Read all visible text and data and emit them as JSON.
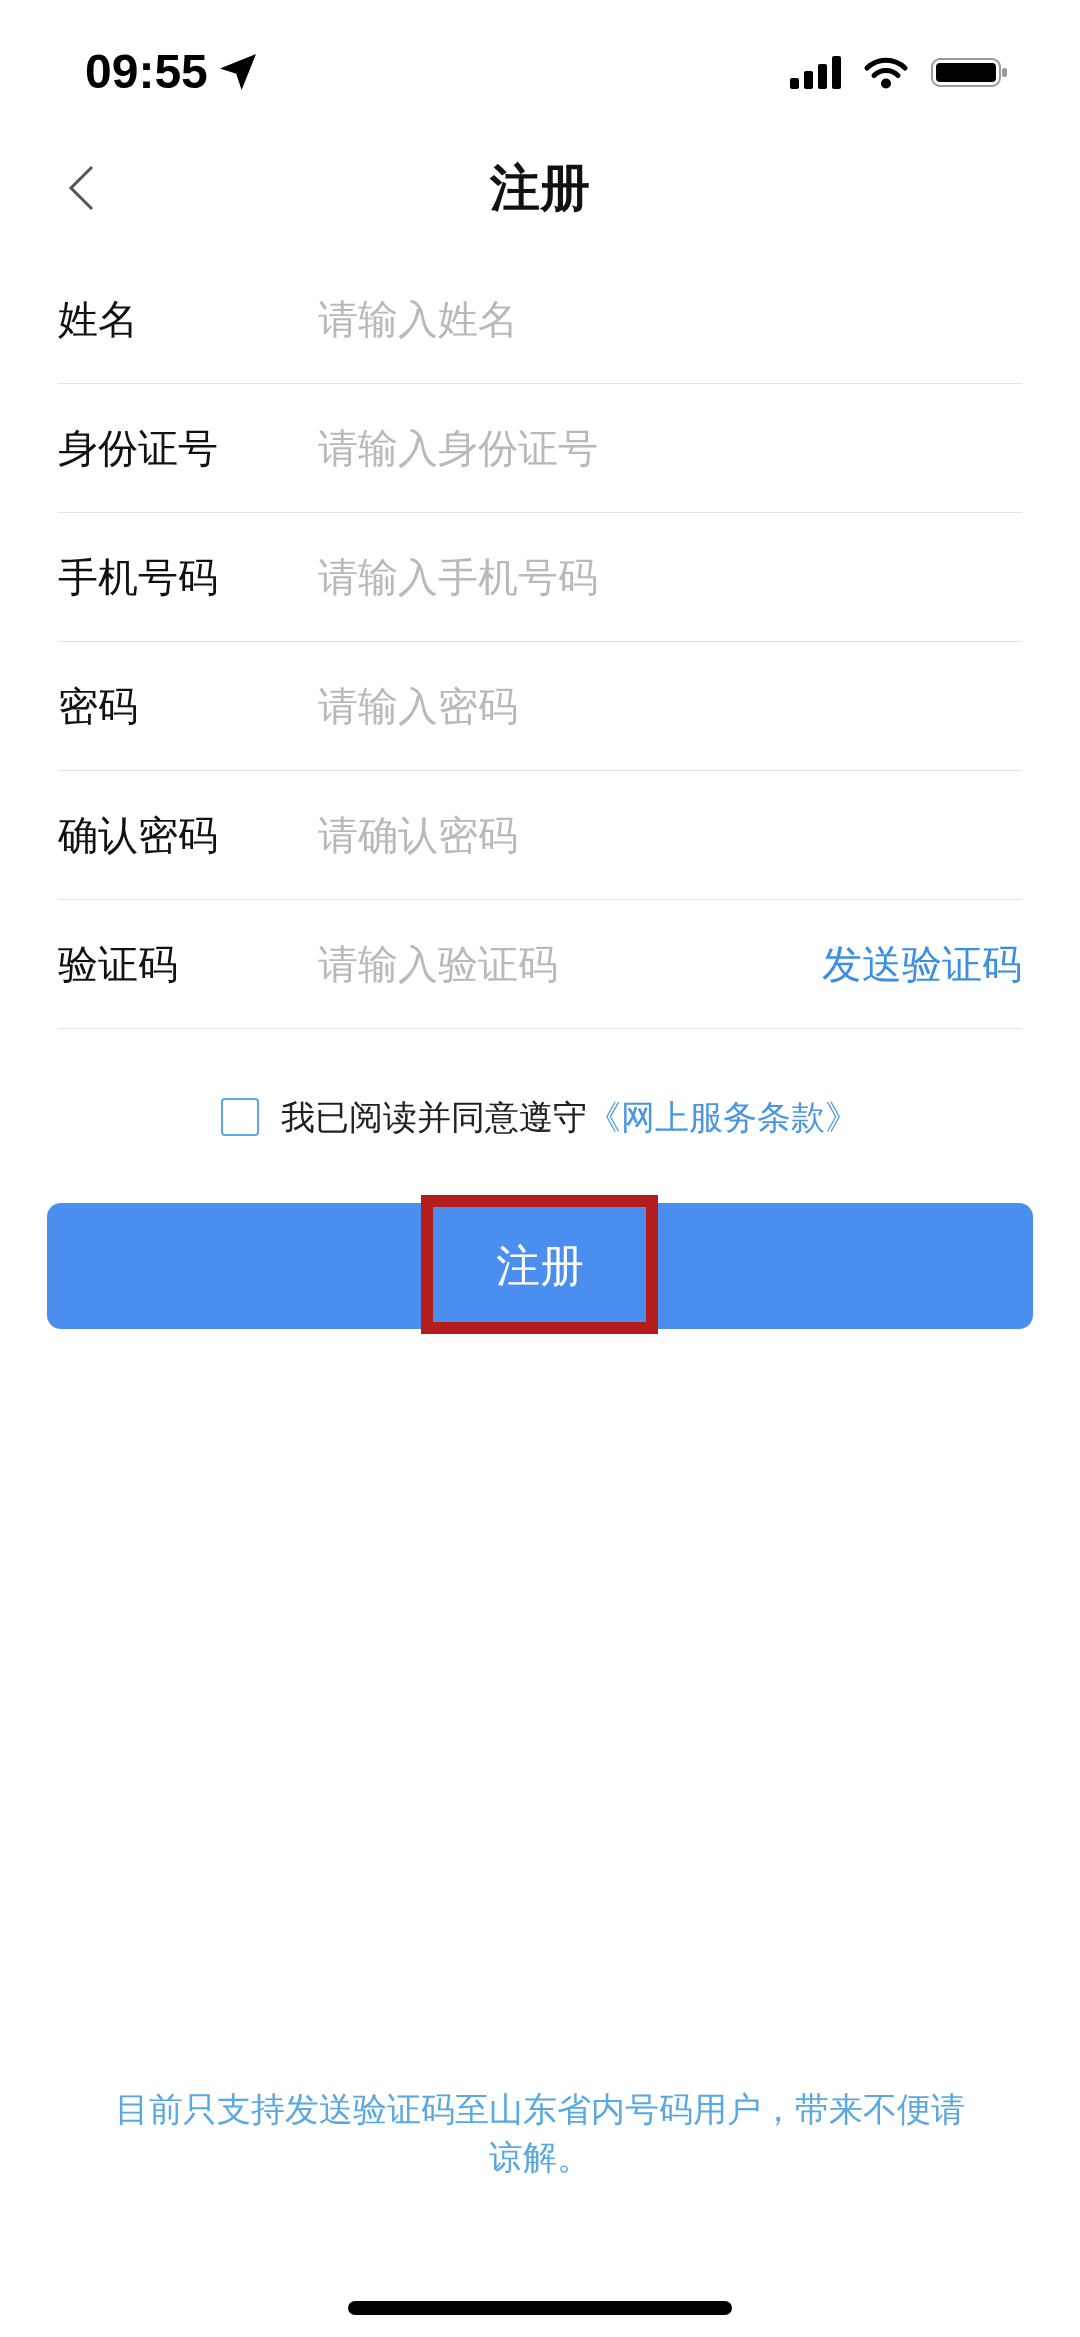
{
  "status_bar": {
    "time": "09:55"
  },
  "header": {
    "title": "注册"
  },
  "fields": [
    {
      "label": "姓名",
      "placeholder": "请输入姓名"
    },
    {
      "label": "身份证号",
      "placeholder": "请输入身份证号"
    },
    {
      "label": "手机号码",
      "placeholder": "请输入手机号码"
    },
    {
      "label": "密码",
      "placeholder": "请输入密码"
    },
    {
      "label": "确认密码",
      "placeholder": "请确认密码"
    },
    {
      "label": "验证码",
      "placeholder": "请输入验证码",
      "action": "发送验证码"
    }
  ],
  "agreement": {
    "checked": false,
    "text": "我已阅读并同意遵守",
    "link": "《网上服务条款》"
  },
  "submit_button": {
    "label": "注册",
    "highlighted": true
  },
  "notice": "目前只支持发送验证码至山东省内号码用户，带来不便请谅解。"
}
